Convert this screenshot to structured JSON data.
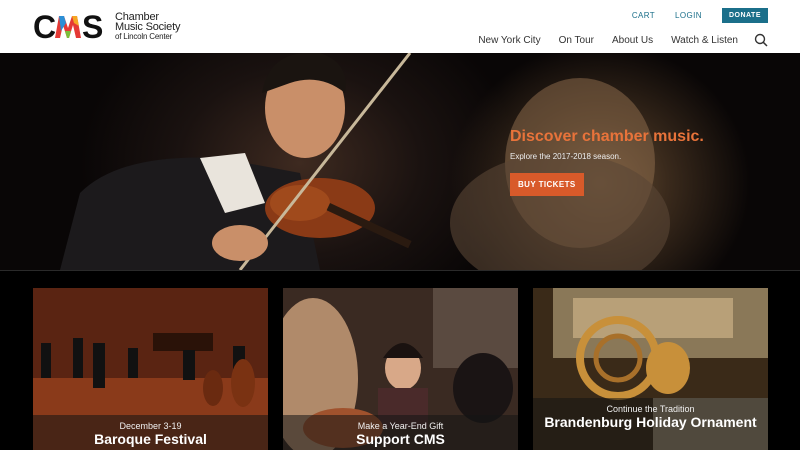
{
  "logo": {
    "mark": "CMS",
    "line1": "Chamber",
    "line2": "Music Society",
    "line3": "of Lincoln Center"
  },
  "utility": {
    "cart": "CART",
    "login": "LOGIN",
    "donate": "DONATE"
  },
  "nav": {
    "items": [
      "New York City",
      "On Tour",
      "About Us",
      "Watch & Listen"
    ]
  },
  "hero": {
    "title": "Discover chamber music.",
    "subtitle": "Explore the 2017-2018 season.",
    "button": "BUY TICKETS"
  },
  "cards": [
    {
      "kicker": "December 3-19",
      "title": "Baroque Festival"
    },
    {
      "kicker": "Make a Year-End Gift",
      "title": "Support CMS"
    },
    {
      "kicker": "Continue the Tradition",
      "title": "Brandenburg Holiday Ornament"
    }
  ],
  "colors": {
    "accent": "#e8733a",
    "button": "#d85a2a",
    "link": "#1b6f8a"
  }
}
